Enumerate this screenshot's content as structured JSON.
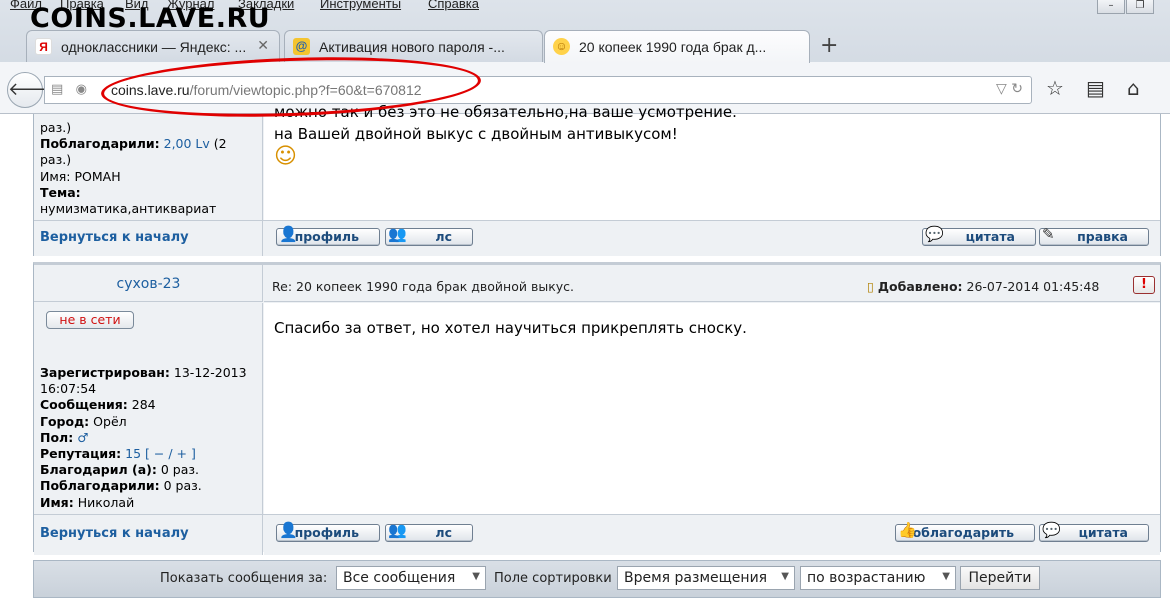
{
  "watermark": "COINS.LAVE.RU",
  "menu": [
    "Файл",
    "Правка",
    "Вид",
    "Журнал",
    "Закладки",
    "Инструменты",
    "Справка"
  ],
  "tabs": [
    {
      "label": "одноклассники — Яндекс: ...",
      "favicon": "Я"
    },
    {
      "label": "Активация нового пароля -...",
      "favicon": "@"
    },
    {
      "label": "20 копеек 1990 года брак д...",
      "favicon": "☺"
    }
  ],
  "url": {
    "host": "coins.lave.ru",
    "path": "/forum/viewtopic.php?f=60&t=670812"
  },
  "post1": {
    "user_lines": [
      {
        "label": "",
        "value": "раз.)"
      },
      {
        "label": "Поблагодарили:",
        "value": "2,00 Lv",
        "tail": "(2 раз.)"
      },
      {
        "label": "",
        "value": "Имя: РОМАН"
      },
      {
        "label": "Тема:",
        "value": "нумизматика,антиквариат"
      }
    ],
    "message_partial": "можно так и без это не обязательно,на ваше усмотрение.",
    "message": "на Вашей двойной выкус с двойным антивыкусом!",
    "smiley": "☺"
  },
  "to_top": "Вернуться к началу",
  "buttons": {
    "profile": "профиль",
    "pm": "лс",
    "quote": "цитата",
    "edit": "правка",
    "thank": "поблагодарить"
  },
  "post2": {
    "author": "сухов-23",
    "subject": "Re: 20 копеек 1990 года брак двойной выкус.",
    "added_label": "Добавлено:",
    "added_value": "26-07-2014 01:45:48",
    "report": "!",
    "offline": "не в сети",
    "message": "Спасибо за ответ, но хотел научиться прикреплять сноску.",
    "info": {
      "registered_label": "Зарегистрирован:",
      "registered_value": "13-12-2013 16:07:54",
      "posts_label": "Сообщения:",
      "posts_value": "284",
      "city_label": "Город:",
      "city_value": "Орёл",
      "gender_label": "Пол:",
      "gender_value": "♂",
      "rep_label": "Репутация:",
      "rep_value": "15",
      "rep_controls": "[ − / + ]",
      "thanked_label": "Благодарил (а):",
      "thanked_value": "0 раз.",
      "thanked_by_label": "Поблагодарили:",
      "thanked_by_value": "0 раз.",
      "name_label": "Имя:",
      "name_value": "Николай"
    }
  },
  "footer": {
    "show_label": "Показать сообщения за:",
    "show_value": "Все сообщения",
    "sort_label": "Поле сортировки",
    "sort_value": "Время размещения",
    "order_value": "по возрастанию",
    "go": "Перейти"
  }
}
